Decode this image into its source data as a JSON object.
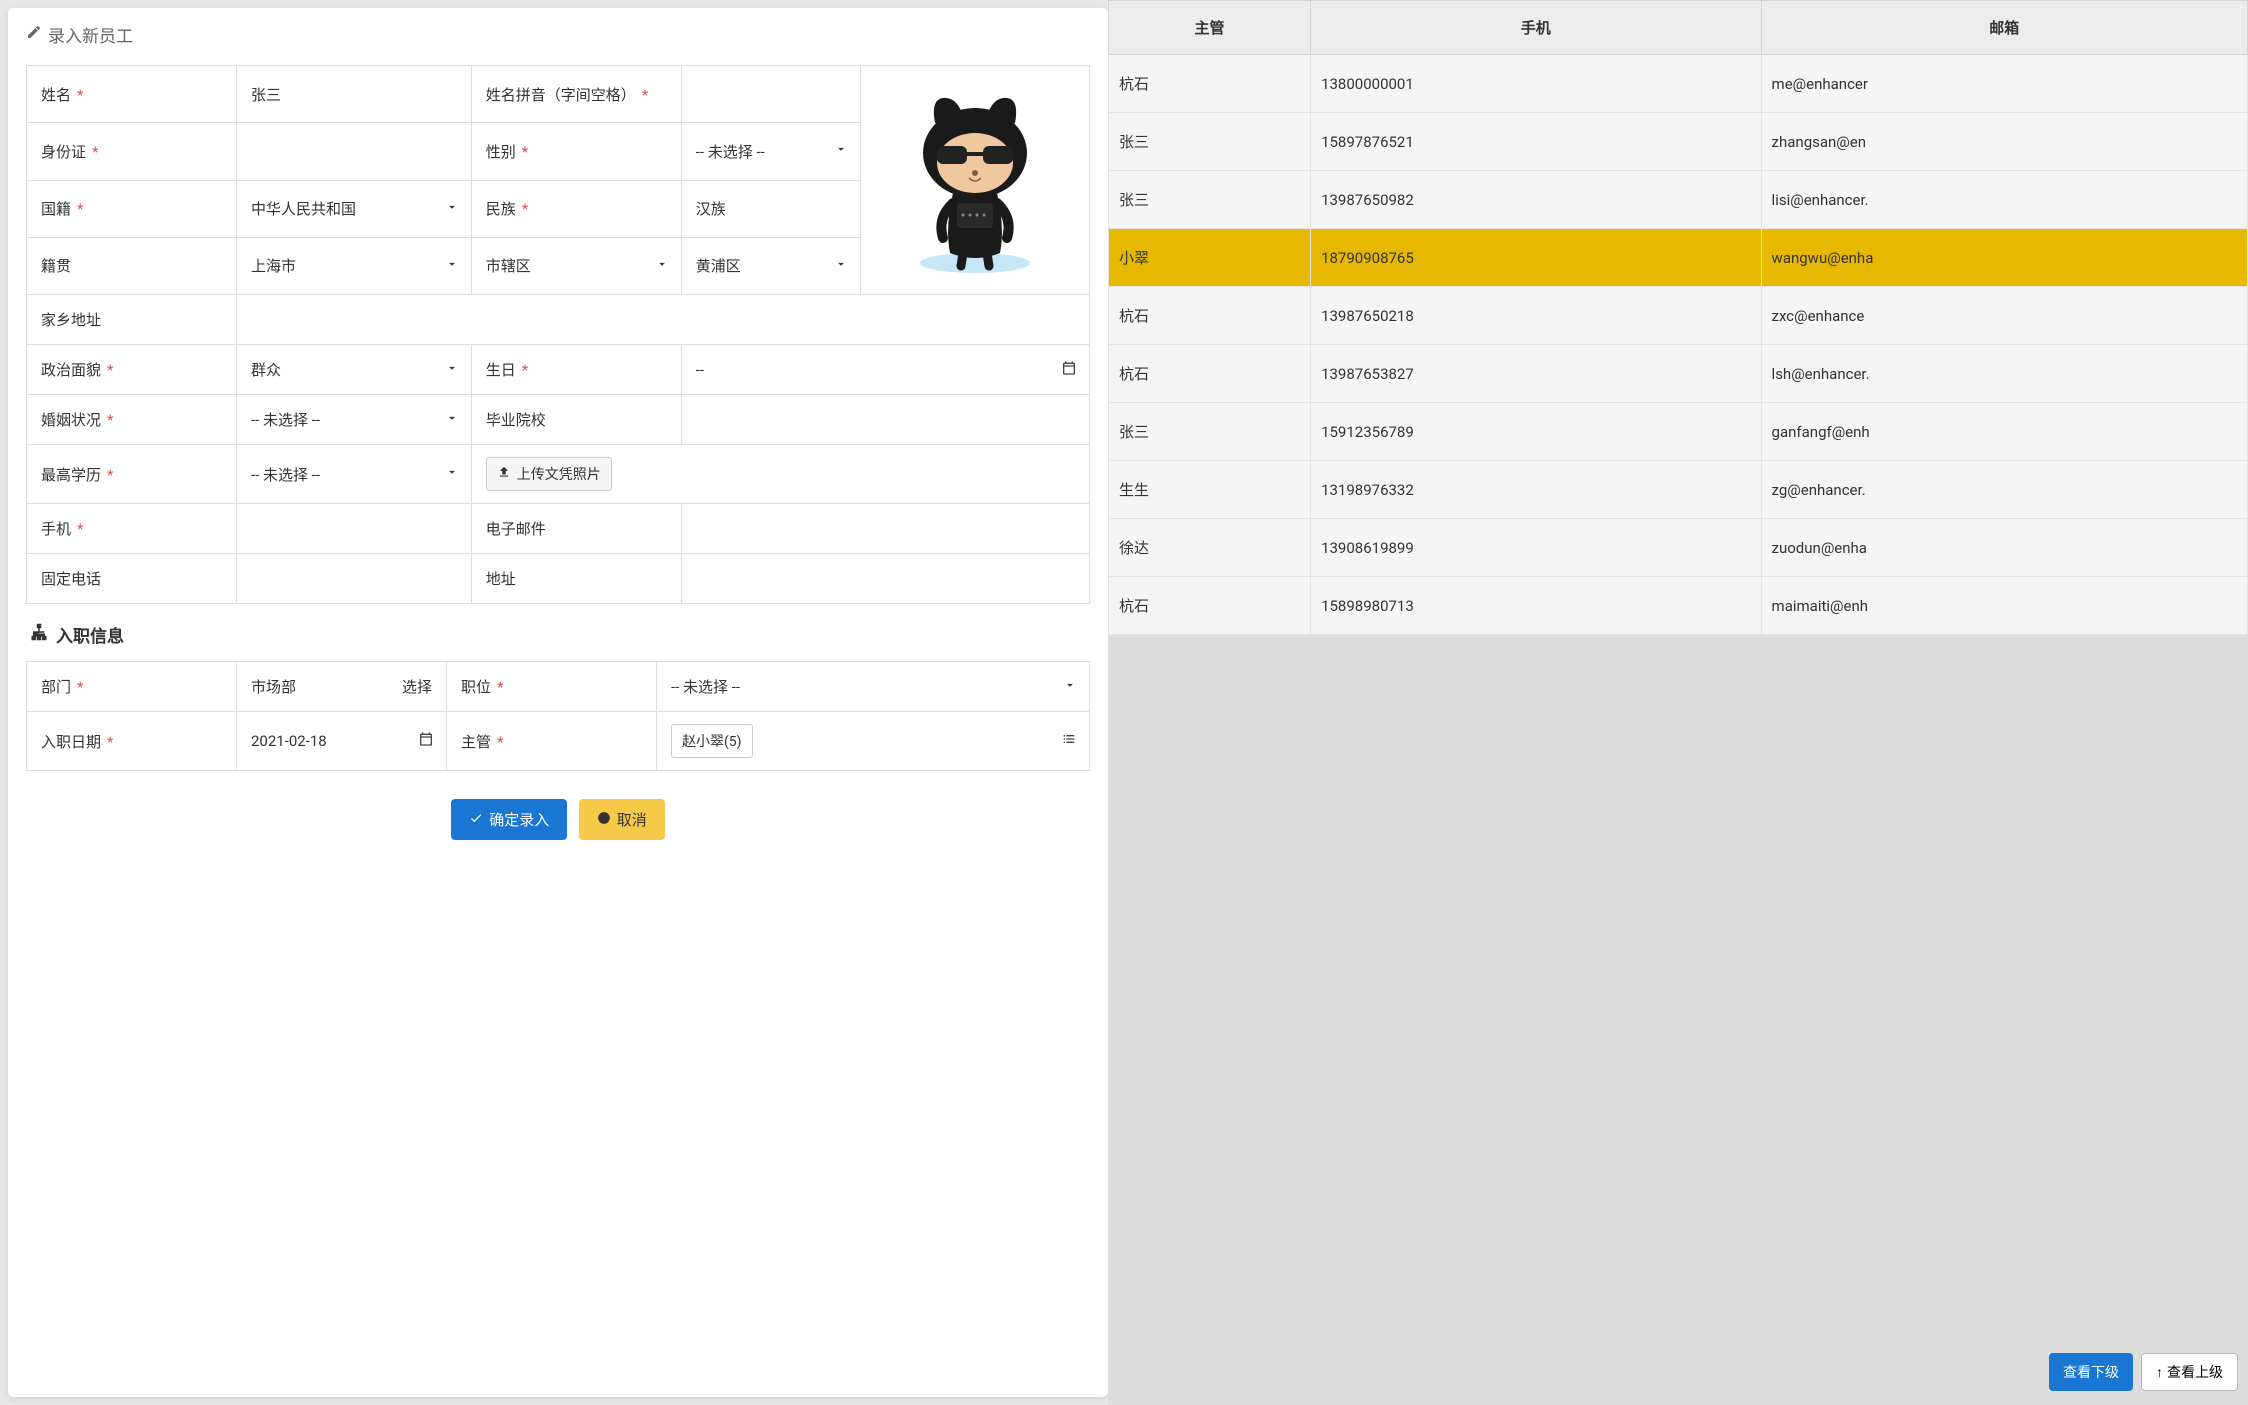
{
  "modal": {
    "title": "录入新员工",
    "fields": {
      "name_label": "姓名",
      "name_value": "张三",
      "pinyin_label": "姓名拼音（字间空格）",
      "pinyin_value": "",
      "id_label": "身份证",
      "id_value": "",
      "gender_label": "性别",
      "gender_value": "-- 未选择 --",
      "nationality_label": "国籍",
      "nationality_value": "中华人民共和国",
      "ethnicity_label": "民族",
      "ethnicity_value": "汉族",
      "origin_label": "籍贯",
      "origin_province": "上海市",
      "origin_city": "市辖区",
      "origin_district": "黄浦区",
      "home_address_label": "家乡地址",
      "home_address_value": "",
      "political_label": "政治面貌",
      "political_value": "群众",
      "birthday_label": "生日",
      "birthday_value": "--",
      "marital_label": "婚姻状况",
      "marital_value": "-- 未选择 --",
      "school_label": "毕业院校",
      "school_value": "",
      "education_label": "最高学历",
      "education_value": "-- 未选择 --",
      "upload_button": "上传文凭照片",
      "mobile_label": "手机",
      "mobile_value": "",
      "email_label": "电子邮件",
      "email_value": "",
      "phone_label": "固定电话",
      "phone_value": "",
      "address_label": "地址",
      "address_value": ""
    },
    "section2": {
      "title": "入职信息",
      "dept_label": "部门",
      "dept_value": "市场部",
      "dept_select": "选择",
      "position_label": "职位",
      "position_value": "-- 未选择 --",
      "hire_date_label": "入职日期",
      "hire_date_value": "2021-02-18",
      "supervisor_label": "主管",
      "supervisor_value": "赵小翠(5)"
    },
    "footer": {
      "confirm": "确定录入",
      "cancel": "取消"
    }
  },
  "table": {
    "headers": {
      "supervisor": "主管",
      "phone": "手机",
      "email": "邮箱"
    },
    "rows": [
      {
        "supervisor": "杭石",
        "phone": "13800000001",
        "email": "me@enhancer",
        "highlight": false
      },
      {
        "supervisor": "张三",
        "phone": "15897876521",
        "email": "zhangsan@en",
        "highlight": false
      },
      {
        "supervisor": "张三",
        "phone": "13987650982",
        "email": "lisi@enhancer.",
        "highlight": false
      },
      {
        "supervisor": "小翠",
        "phone": "18790908765",
        "email": "wangwu@enha",
        "highlight": true
      },
      {
        "supervisor": "杭石",
        "phone": "13987650218",
        "email": "zxc@enhance",
        "highlight": false
      },
      {
        "supervisor": "杭石",
        "phone": "13987653827",
        "email": "lsh@enhancer.",
        "highlight": false
      },
      {
        "supervisor": "张三",
        "phone": "15912356789",
        "email": "ganfangf@enh",
        "highlight": false
      },
      {
        "supervisor": "生生",
        "phone": "13198976332",
        "email": "zg@enhancer.",
        "highlight": false
      },
      {
        "supervisor": "徐达",
        "phone": "13908619899",
        "email": "zuodun@enha",
        "highlight": false
      },
      {
        "supervisor": "杭石",
        "phone": "15898980713",
        "email": "maimaiti@enh",
        "highlight": false
      }
    ],
    "footer": {
      "view_sub": "查看下级",
      "view_sup": "查看上级"
    }
  }
}
